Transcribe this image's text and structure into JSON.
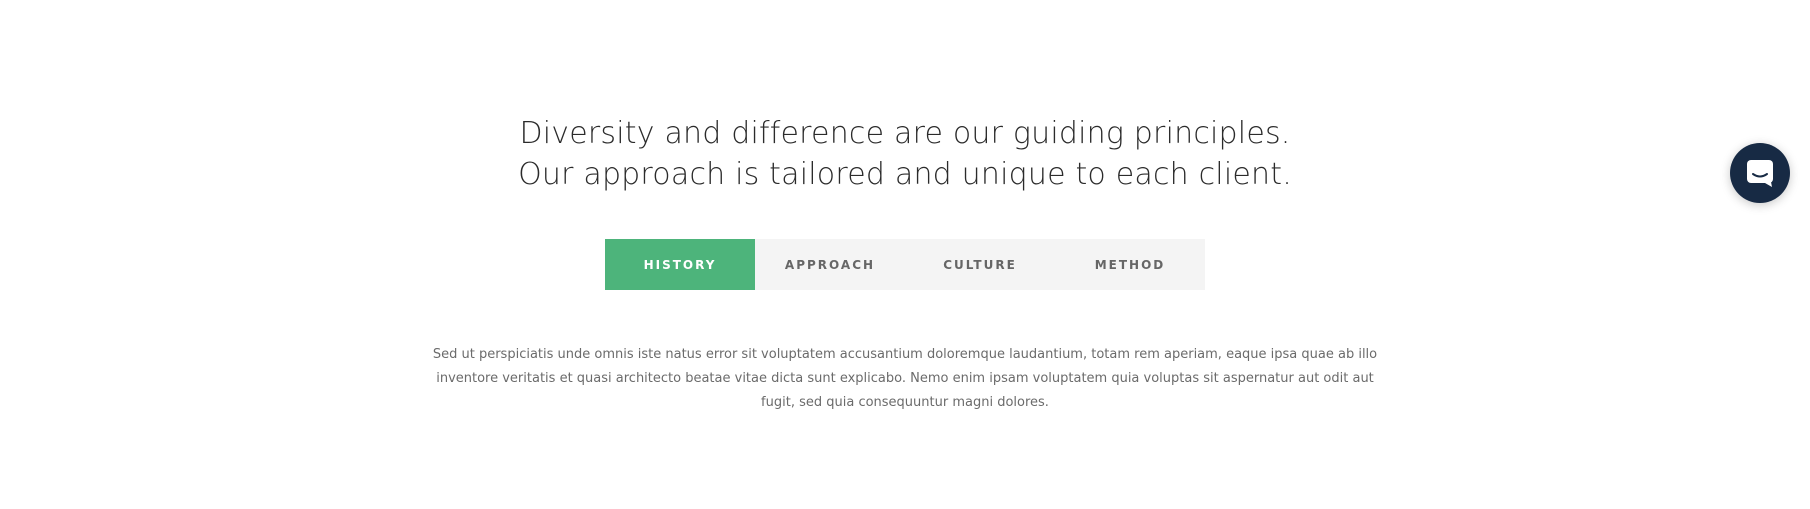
{
  "headline": {
    "line1": "Diversity and difference are our guiding principles.",
    "line2": "Our approach is tailored and unique to each client."
  },
  "tabs": [
    {
      "label": "HISTORY",
      "active": true
    },
    {
      "label": "APPROACH",
      "active": false
    },
    {
      "label": "CULTURE",
      "active": false
    },
    {
      "label": "METHOD",
      "active": false
    }
  ],
  "content": {
    "text": "Sed ut perspiciatis unde omnis iste natus error sit voluptatem accusantium doloremque laudantium, totam rem aperiam, eaque ipsa quae ab illo inventore veritatis et quasi architecto beatae vitae dicta sunt explicabo. Nemo enim ipsam voluptatem quia voluptas sit aspernatur aut odit aut fugit, sed quia consequuntur magni dolores."
  },
  "chat_launcher": {
    "icon": "chat-icon"
  },
  "colors": {
    "accent": "#4db47b",
    "tab_bg": "#f4f4f4",
    "launcher_bg": "#172a44",
    "headline": "#2b2b2b",
    "body_text": "#6b6b6b"
  }
}
